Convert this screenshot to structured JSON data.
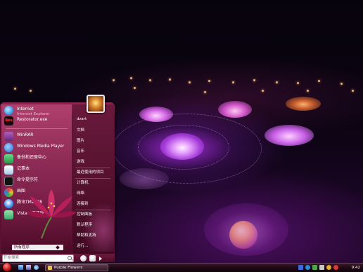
{
  "window_title": "Purple Flowers",
  "start_menu": {
    "pinned": [
      {
        "label": "Internet",
        "sublabel": "Internet Explorer",
        "icon": "ie-icon",
        "color": "#3aa0e8"
      },
      {
        "label": "Restorator.exe",
        "sublabel": "",
        "icon": "restorator-icon",
        "badge": "Res",
        "color": "#c02020"
      }
    ],
    "programs": [
      {
        "label": "WinRAR",
        "icon": "winrar-icon",
        "color": "#8a3a9a"
      },
      {
        "label": "Windows Media Player",
        "icon": "media-player-icon",
        "color": "#2a6ad8"
      },
      {
        "label": "备份和还原中心",
        "icon": "backup-icon",
        "color": "#2a9a4a"
      },
      {
        "label": "记事本",
        "icon": "notepad-icon",
        "color": "#cfe2f2"
      },
      {
        "label": "命令提示符",
        "icon": "cmd-icon",
        "color": "#111111"
      },
      {
        "label": "画图",
        "icon": "paint-icon",
        "color": "#e0a030"
      },
      {
        "label": "腾讯TM2008",
        "icon": "tm-icon",
        "color": "#3a88e8"
      },
      {
        "label": "Vista一键还原",
        "icon": "restore-icon",
        "color": "#3aa86a"
      }
    ],
    "all_programs": "所有程序",
    "search_placeholder": "开始搜索",
    "right_links": [
      "dzart",
      "文档",
      "图片",
      "音乐",
      "游戏",
      "最近使用的项目",
      "计算机",
      "网络",
      "连接到",
      "控制面板",
      "默认程序",
      "帮助和支持",
      "运行..."
    ]
  },
  "taskbar": {
    "task_label": "Purple Flowers",
    "clock": "9:42",
    "quick_launch": [
      "show-desktop-icon",
      "switch-windows-icon",
      "ie-quicklaunch-icon"
    ],
    "tray_icons": [
      "language-icon",
      "help-icon",
      "network-icon",
      "volume-icon",
      "security-icon",
      "antivirus-icon"
    ]
  },
  "colors": {
    "accent": "#8e2550",
    "taskbar": "#1e0814",
    "start_orb": "#c01818"
  }
}
